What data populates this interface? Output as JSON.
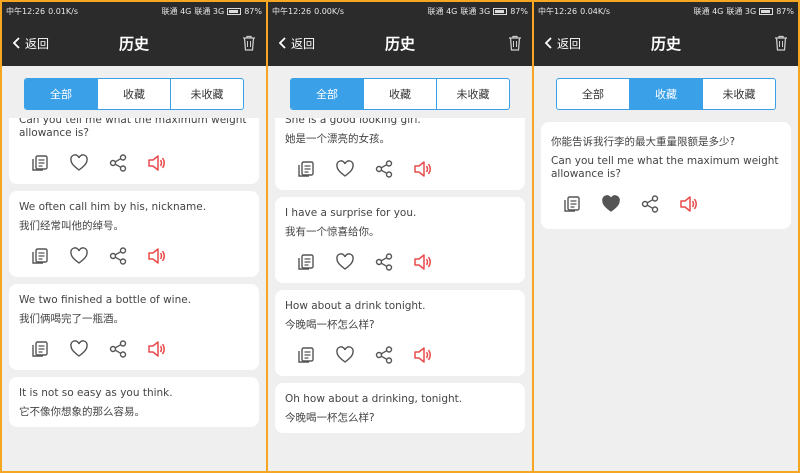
{
  "status": [
    {
      "time": "中午12:26",
      "speed": "0.01K/s",
      "carrier1": "联通 4G",
      "carrier2": "联通 3G",
      "battery": "87%"
    },
    {
      "time": "中午12:26",
      "speed": "0.00K/s",
      "carrier1": "联通 4G",
      "carrier2": "联通 3G",
      "battery": "87%"
    },
    {
      "time": "中午12:26",
      "speed": "0.04K/s",
      "carrier1": "联通 4G",
      "carrier2": "联通 3G",
      "battery": "87%"
    }
  ],
  "nav": {
    "back_label": "返回",
    "title": "历史"
  },
  "tabs": [
    "全部",
    "收藏",
    "未收藏"
  ],
  "screens": [
    {
      "active_tab": 0,
      "cards": [
        {
          "en": "Can you tell me what the maximum weight allowance is?",
          "zh": ""
        },
        {
          "en": "We often call him by his, nickname.",
          "zh": "我们经常叫他的绰号。"
        },
        {
          "en": "We two finished a bottle of wine.",
          "zh": "我们俩喝完了一瓶酒。"
        },
        {
          "en": "It is not so easy as you think.",
          "zh": "它不像你想象的那么容易。"
        }
      ]
    },
    {
      "active_tab": 0,
      "cards": [
        {
          "en": "She is a good looking girl.",
          "zh": "她是一个漂亮的女孩。"
        },
        {
          "en": "I have a surprise for you.",
          "zh": "我有一个惊喜给你。"
        },
        {
          "en": "How about a drink tonight.",
          "zh": "今晚喝一杯怎么样?"
        },
        {
          "en": "Oh how about a drinking, tonight.",
          "zh": "今晚喝一杯怎么样?"
        }
      ]
    },
    {
      "active_tab": 1,
      "cards": [
        {
          "zh": "你能告诉我行李的最大重量限额是多少?",
          "en": "Can you tell me what the maximum weight allowance is?"
        }
      ]
    }
  ],
  "colors": {
    "accent": "#3aa0e8",
    "sound": "#e84b4b",
    "bar": "#2b2b2b",
    "frame": "#f5a623"
  }
}
